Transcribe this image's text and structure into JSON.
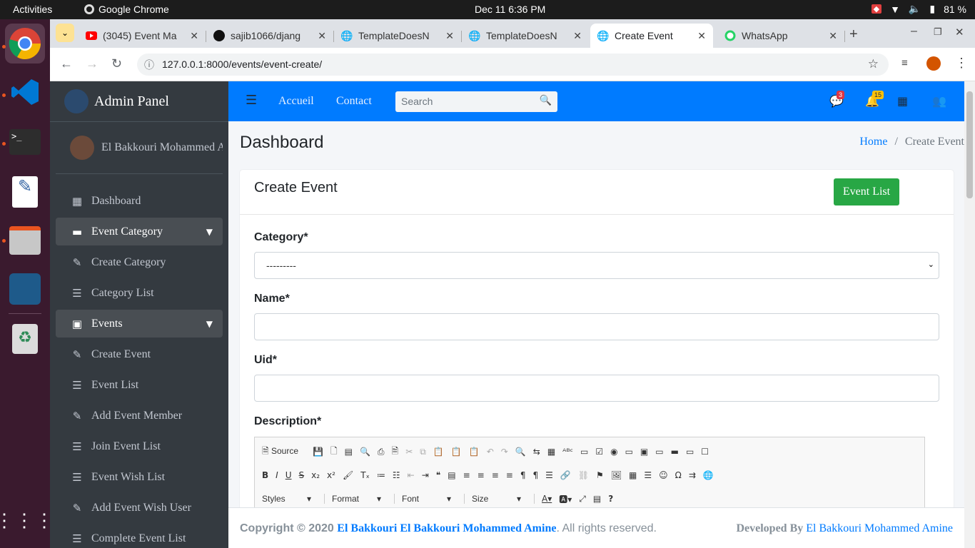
{
  "os": {
    "activities": "Activities",
    "app_name": "Google Chrome",
    "clock": "Dec 11  6:36 PM",
    "battery": "81 %"
  },
  "browser": {
    "tabs": [
      {
        "title": "(3045) Event Ma",
        "icon": "youtube-icon",
        "color": "#ff0000"
      },
      {
        "title": "sajib1066/djang",
        "icon": "github-icon",
        "color": "#000000"
      },
      {
        "title": "TemplateDoesN",
        "icon": "globe-icon",
        "color": "#5f6368"
      },
      {
        "title": "TemplateDoesN",
        "icon": "globe-icon",
        "color": "#5f6368"
      },
      {
        "title": "Create Event",
        "icon": "globe-icon",
        "color": "#5f6368"
      },
      {
        "title": "WhatsApp",
        "icon": "whatsapp-icon",
        "color": "#25d366"
      }
    ],
    "url": "127.0.0.1:8000/events/event-create/"
  },
  "sidebar": {
    "brand": "Admin Panel",
    "user": "El Bakkouri Mohammed Amine",
    "items": [
      {
        "label": "Dashboard",
        "icon": "grid-icon"
      },
      {
        "label": "Event Category",
        "icon": "folder-icon",
        "open": true
      },
      {
        "label": "Create Category",
        "icon": "edit-icon"
      },
      {
        "label": "Category List",
        "icon": "list-icon"
      },
      {
        "label": "Events",
        "icon": "calendar-icon",
        "open": true
      },
      {
        "label": "Create Event",
        "icon": "edit-icon"
      },
      {
        "label": "Event List",
        "icon": "list-icon"
      },
      {
        "label": "Add Event Member",
        "icon": "edit-icon"
      },
      {
        "label": "Join Event List",
        "icon": "list-icon"
      },
      {
        "label": "Event Wish List",
        "icon": "list-icon"
      },
      {
        "label": "Add Event Wish User",
        "icon": "edit-icon"
      },
      {
        "label": "Complete Event List",
        "icon": "list-icon"
      }
    ]
  },
  "navbar": {
    "links": [
      "Accueil",
      "Contact"
    ],
    "search_placeholder": "Search",
    "messages_badge": "3",
    "notifications_badge": "15",
    "accent": "#007bff"
  },
  "page": {
    "title": "Dashboard",
    "breadcrumb_home": "Home",
    "breadcrumb_sep": "/",
    "breadcrumb_current": "Create Event"
  },
  "form": {
    "card_title": "Create Event",
    "event_list_button": "Event List",
    "category_label": "Category*",
    "category_value": "---------",
    "name_label": "Name*",
    "uid_label": "Uid*",
    "description_label": "Description*",
    "editor": {
      "source": "Source",
      "styles": "Styles",
      "format": "Format",
      "font": "Font",
      "size": "Size"
    }
  },
  "footer": {
    "copyright": "Copyright © 2020",
    "author": "El Bakkouri El Bakkouri Mohammed Amine",
    "rights": ". All rights reserved.",
    "developed_by": "Developed By",
    "developer": "El Bakkouri Mohammed Amine"
  }
}
